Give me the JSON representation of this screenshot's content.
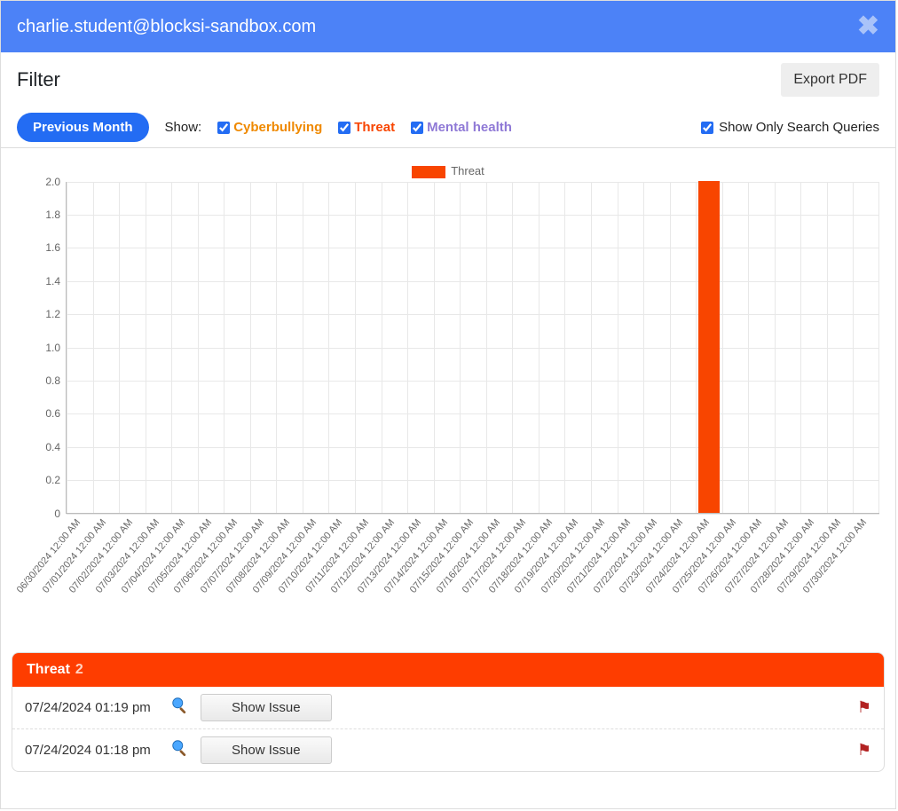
{
  "header": {
    "email": "charlie.student@blocksi-sandbox.com"
  },
  "filter": {
    "title": "Filter",
    "export_label": "Export PDF",
    "prev_month_label": "Previous Month",
    "show_label": "Show:",
    "cyber_label": "Cyberbullying",
    "threat_label": "Threat",
    "mental_label": "Mental health",
    "search_queries_label": "Show Only Search Queries"
  },
  "chart_data": {
    "type": "bar",
    "legend": "Threat",
    "ylim": [
      0,
      2.0
    ],
    "y_ticks": [
      "0",
      "0.2",
      "0.4",
      "0.6",
      "0.8",
      "1.0",
      "1.2",
      "1.4",
      "1.6",
      "1.8",
      "2.0"
    ],
    "categories": [
      "06/30/2024 12:00 AM",
      "07/01/2024 12:00 AM",
      "07/02/2024 12:00 AM",
      "07/03/2024 12:00 AM",
      "07/04/2024 12:00 AM",
      "07/05/2024 12:00 AM",
      "07/06/2024 12:00 AM",
      "07/07/2024 12:00 AM",
      "07/08/2024 12:00 AM",
      "07/09/2024 12:00 AM",
      "07/10/2024 12:00 AM",
      "07/11/2024 12:00 AM",
      "07/12/2024 12:00 AM",
      "07/13/2024 12:00 AM",
      "07/14/2024 12:00 AM",
      "07/15/2024 12:00 AM",
      "07/16/2024 12:00 AM",
      "07/17/2024 12:00 AM",
      "07/18/2024 12:00 AM",
      "07/19/2024 12:00 AM",
      "07/20/2024 12:00 AM",
      "07/21/2024 12:00 AM",
      "07/22/2024 12:00 AM",
      "07/23/2024 12:00 AM",
      "07/24/2024 12:00 AM",
      "07/25/2024 12:00 AM",
      "07/26/2024 12:00 AM",
      "07/27/2024 12:00 AM",
      "07/28/2024 12:00 AM",
      "07/29/2024 12:00 AM",
      "07/30/2024 12:00 AM"
    ],
    "values": [
      0,
      0,
      0,
      0,
      0,
      0,
      0,
      0,
      0,
      0,
      0,
      0,
      0,
      0,
      0,
      0,
      0,
      0,
      0,
      0,
      0,
      0,
      0,
      0,
      2,
      0,
      0,
      0,
      0,
      0,
      0
    ]
  },
  "threat_section": {
    "title": "Threat",
    "count": "2",
    "show_issue_label": "Show Issue",
    "issues": [
      {
        "time": "07/24/2024 01:19 pm"
      },
      {
        "time": "07/24/2024 01:18 pm"
      }
    ]
  }
}
